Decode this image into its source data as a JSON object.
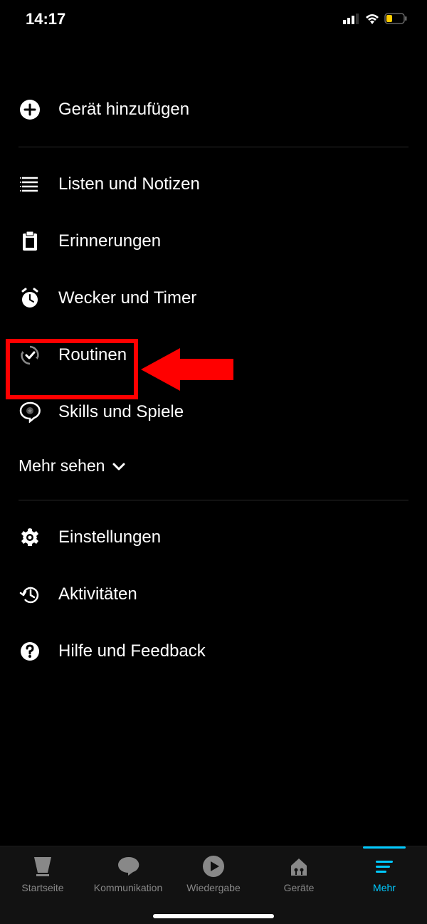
{
  "status": {
    "time": "14:17"
  },
  "menu": {
    "add_device": "Gerät hinzufügen",
    "lists": "Listen und Notizen",
    "reminders": "Erinnerungen",
    "alarms": "Wecker und Timer",
    "routines": "Routinen",
    "skills": "Skills und Spiele",
    "see_more": "Mehr sehen",
    "settings": "Einstellungen",
    "activity": "Aktivitäten",
    "help": "Hilfe und Feedback"
  },
  "nav": {
    "home": "Startseite",
    "communication": "Kommunikation",
    "play": "Wiedergabe",
    "devices": "Geräte",
    "more": "Mehr"
  }
}
